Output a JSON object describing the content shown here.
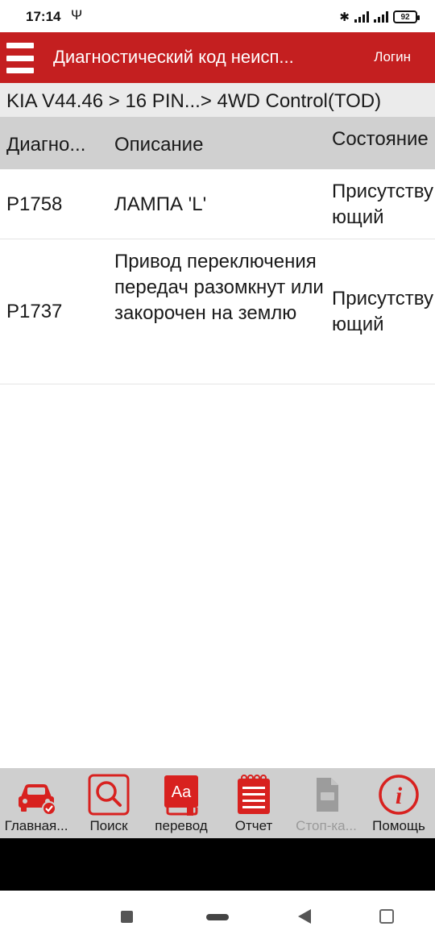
{
  "status_bar": {
    "time": "17:14",
    "usb_icon": "usb-icon",
    "battery_level": "92"
  },
  "app_bar": {
    "title": "Диагностический код неисп...",
    "login_label": "Логин",
    "accent_color": "#c41f20"
  },
  "breadcrumb": {
    "text": "KIA V44.46 > 16 PIN...> 4WD Control(TOD)"
  },
  "table": {
    "headers": [
      "Диагно...",
      "Описание",
      "Состояние"
    ],
    "rows": [
      {
        "code": "P1758",
        "description": "ЛАМПА 'L'",
        "state": "Присутствующий"
      },
      {
        "code": "P1737",
        "description": "Привод переключения передач разомкнут или закорочен на землю",
        "state": "Присутствующий"
      }
    ]
  },
  "toolbar": {
    "items": [
      {
        "label": "Главная...",
        "icon": "car-check-icon",
        "enabled": true
      },
      {
        "label": "Поиск",
        "icon": "search-icon",
        "enabled": true
      },
      {
        "label": "перевод",
        "icon": "translate-icon",
        "enabled": true
      },
      {
        "label": "Отчет",
        "icon": "report-icon",
        "enabled": true
      },
      {
        "label": "Стоп-ка...",
        "icon": "document-icon",
        "enabled": false
      },
      {
        "label": "Помощь",
        "icon": "info-icon",
        "enabled": true
      }
    ]
  }
}
